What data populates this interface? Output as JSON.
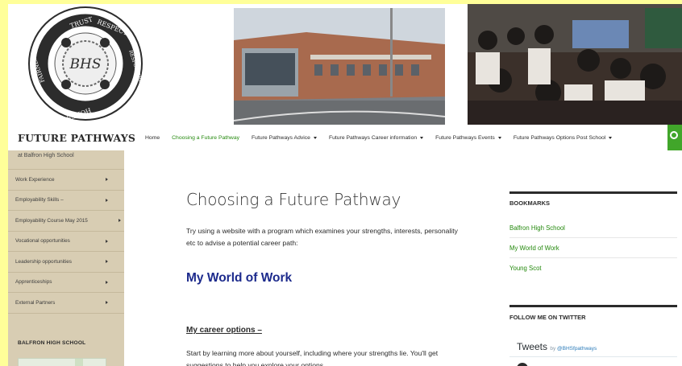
{
  "banner": {
    "crest_words": [
      "TRUST",
      "RESPECT",
      "RESPONSIBILITY",
      "HONESTY",
      "FAIRNESS"
    ],
    "crest_monogram": "BHS"
  },
  "header": {
    "site_title": "FUTURE PATHWAYS",
    "tagline": "at Balfron High School"
  },
  "nav": {
    "items": [
      {
        "label": "Home",
        "active": false,
        "dropdown": false
      },
      {
        "label": "Choosing a Future Pathway",
        "active": true,
        "dropdown": false
      },
      {
        "label": "Future Pathways Advice",
        "active": false,
        "dropdown": true
      },
      {
        "label": "Future Pathways Career information",
        "active": false,
        "dropdown": true
      },
      {
        "label": "Future Pathways Events",
        "active": false,
        "dropdown": true
      },
      {
        "label": "Future Pathways Options Post School",
        "active": false,
        "dropdown": true
      }
    ],
    "search_icon": "search-icon"
  },
  "sidebar": {
    "items": [
      {
        "label": "Work Experience"
      },
      {
        "label": "Employability Skills –"
      },
      {
        "label": "Employability Course May 2015"
      },
      {
        "label": "Vocational opportunities"
      },
      {
        "label": "Leadership opportunities"
      },
      {
        "label": "Apprenticeships"
      },
      {
        "label": "External Partners"
      }
    ],
    "heading": "BALFRON HIGH SCHOOL"
  },
  "main": {
    "title": "Choosing a Future Pathway",
    "intro": "Try using a website with a program which examines your strengths, interests, personality etc to advise a potential career path:",
    "link_heading": "My World of Work",
    "career_heading": "My career options –",
    "career_text": "Start by learning more about yourself, including where your strengths lie. You'll get suggestions to help you explore your options."
  },
  "widgets": {
    "bookmarks_title": "BOOKMARKS",
    "bookmarks": [
      "Balfron High School",
      "My World of Work",
      "Young Scot"
    ],
    "twitter_title": "FOLLOW ME ON TWITTER",
    "tweets_label": "Tweets",
    "tweets_by": "by",
    "tweets_handle": "@BHSfpathways"
  },
  "colors": {
    "page_bg": "#ffff99",
    "accent_green": "#24890d",
    "sidebar_bg": "#d8cdb3",
    "heading_blue": "#1c2a8c"
  }
}
